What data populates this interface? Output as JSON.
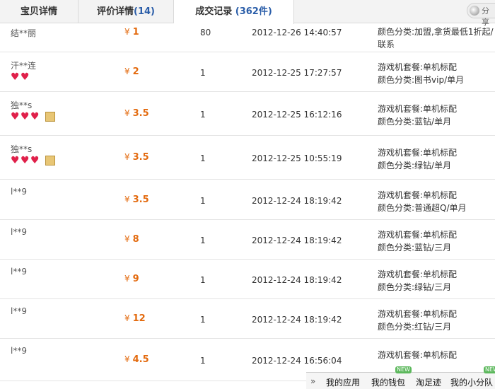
{
  "tabs": [
    {
      "label": "宝贝详情"
    },
    {
      "label": "评价详情",
      "count": "(14)"
    },
    {
      "label": "成交记录",
      "count": "(362件)"
    }
  ],
  "share": {
    "label": "分享"
  },
  "records": [
    {
      "buyer": "结**丽",
      "hearts": 0,
      "vip": false,
      "price": "1",
      "qty": "80",
      "time": "2012-12-26 14:40:57",
      "spec1": "颜色分类:加盟,拿货最低1折起/",
      "spec2": "联系"
    },
    {
      "buyer": "汗**连",
      "hearts": 2,
      "vip": false,
      "price": "2",
      "qty": "1",
      "time": "2012-12-25 17:27:57",
      "spec1": "游戏机套餐:单机标配",
      "spec2": "颜色分类:图书vip/单月"
    },
    {
      "buyer": "独**s",
      "hearts": 3,
      "vip": true,
      "price": "3.5",
      "qty": "1",
      "time": "2012-12-25 16:12:16",
      "spec1": "游戏机套餐:单机标配",
      "spec2": "颜色分类:蓝钻/单月"
    },
    {
      "buyer": "独**s",
      "hearts": 3,
      "vip": true,
      "price": "3.5",
      "qty": "1",
      "time": "2012-12-25 10:55:19",
      "spec1": "游戏机套餐:单机标配",
      "spec2": "颜色分类:绿钻/单月"
    },
    {
      "buyer": "l**9",
      "hearts": 0,
      "vip": false,
      "price": "3.5",
      "qty": "1",
      "time": "2012-12-24 18:19:42",
      "spec1": "游戏机套餐:单机标配",
      "spec2": "颜色分类:普通超Q/单月"
    },
    {
      "buyer": "l**9",
      "hearts": 0,
      "vip": false,
      "price": "8",
      "qty": "1",
      "time": "2012-12-24 18:19:42",
      "spec1": "游戏机套餐:单机标配",
      "spec2": "颜色分类:蓝钻/三月"
    },
    {
      "buyer": "l**9",
      "hearts": 0,
      "vip": false,
      "price": "9",
      "qty": "1",
      "time": "2012-12-24 18:19:42",
      "spec1": "游戏机套餐:单机标配",
      "spec2": "颜色分类:绿钻/三月"
    },
    {
      "buyer": "l**9",
      "hearts": 0,
      "vip": false,
      "price": "12",
      "qty": "1",
      "time": "2012-12-24 18:19:42",
      "spec1": "游戏机套餐:单机标配",
      "spec2": "颜色分类:红钻/三月"
    },
    {
      "buyer": "l**9",
      "hearts": 0,
      "vip": false,
      "price": "4.5",
      "qty": "1",
      "time": "2012-12-24 16:56:04",
      "spec1": "游戏机套餐:单机标配",
      "spec2": ""
    }
  ],
  "currency": "¥",
  "toolbar": {
    "items": [
      "我的应用",
      "我的钱包",
      "淘足迹",
      "我的小分队"
    ],
    "new_badge": "NEW"
  },
  "colors": {
    "price": "#e36a0e",
    "count": "#2b5ea9",
    "heart": "#e0204a"
  }
}
